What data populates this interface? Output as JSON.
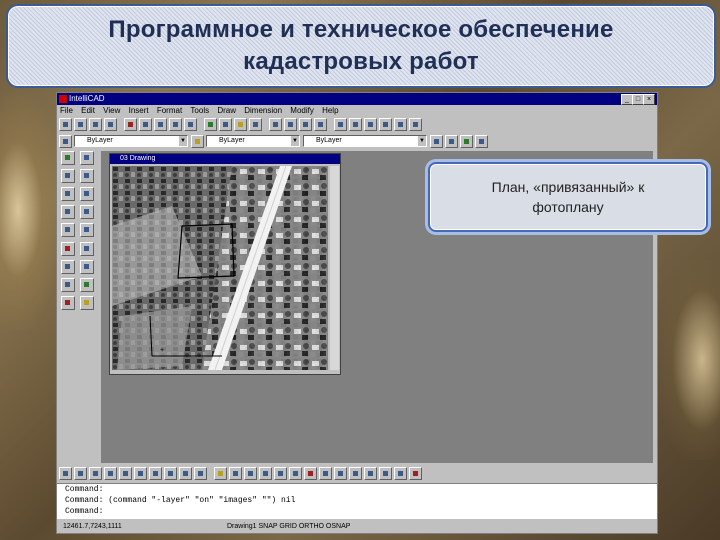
{
  "slide": {
    "title_line1": "Программное и техническое обеспечение",
    "title_line2": "кадастровых работ",
    "callout_line1": "План, «привязанный» к",
    "callout_line2": "фотоплану"
  },
  "app": {
    "window_title": "IntelliCAD",
    "menu": [
      "File",
      "Edit",
      "View",
      "Insert",
      "Format",
      "Tools",
      "Draw",
      "Dimension",
      "Modify",
      "Help"
    ],
    "layer_value": "ByLayer",
    "color_value": "ByLayer",
    "linetype_value": "ByLayer",
    "image_window_title": "03 Drawing"
  },
  "command": {
    "line1": "Command:",
    "line2": "Command: (command \"-layer\" \"on\" \"images\" \"\") nil",
    "line3": "Command:"
  },
  "status": {
    "coords": "12461.7,7243,1111",
    "mode": "Drawing1 SNAP GRID ORTHO OSNAP"
  },
  "icons": {
    "image": "aerial-photo-image"
  }
}
